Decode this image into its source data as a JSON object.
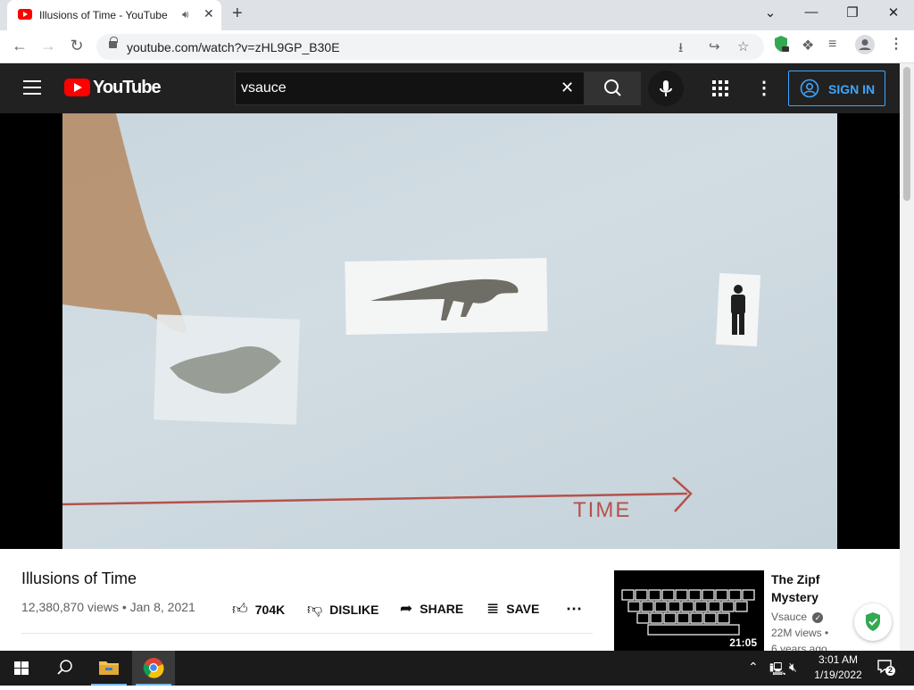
{
  "browser": {
    "tab_title": "Illusions of Time - YouTube",
    "url": "youtube.com/watch?v=zHL9GP_B30E"
  },
  "youtube": {
    "wordmark": "YouTube",
    "search_value": "vsauce",
    "sign_in_label": "SIGN IN"
  },
  "video": {
    "time_label": "TIME",
    "title": "Illusions of Time",
    "meta": "12,380,870 views • Jan 8, 2021",
    "like_count": "704K",
    "dislike_label": "DISLIKE",
    "share_label": "SHARE",
    "save_label": "SAVE"
  },
  "recommended": {
    "title": "The Zipf Mystery",
    "channel": "Vsauce",
    "views": "22M views •",
    "age": "6 years ago",
    "duration": "21:05"
  },
  "taskbar": {
    "time": "3:01 AM",
    "date": "1/19/2022",
    "notification_count": "2"
  },
  "colors": {
    "yt_red": "#ff0000",
    "yt_dark": "#212121",
    "link_blue": "#3ea6ff",
    "shield_green": "#34a853"
  }
}
